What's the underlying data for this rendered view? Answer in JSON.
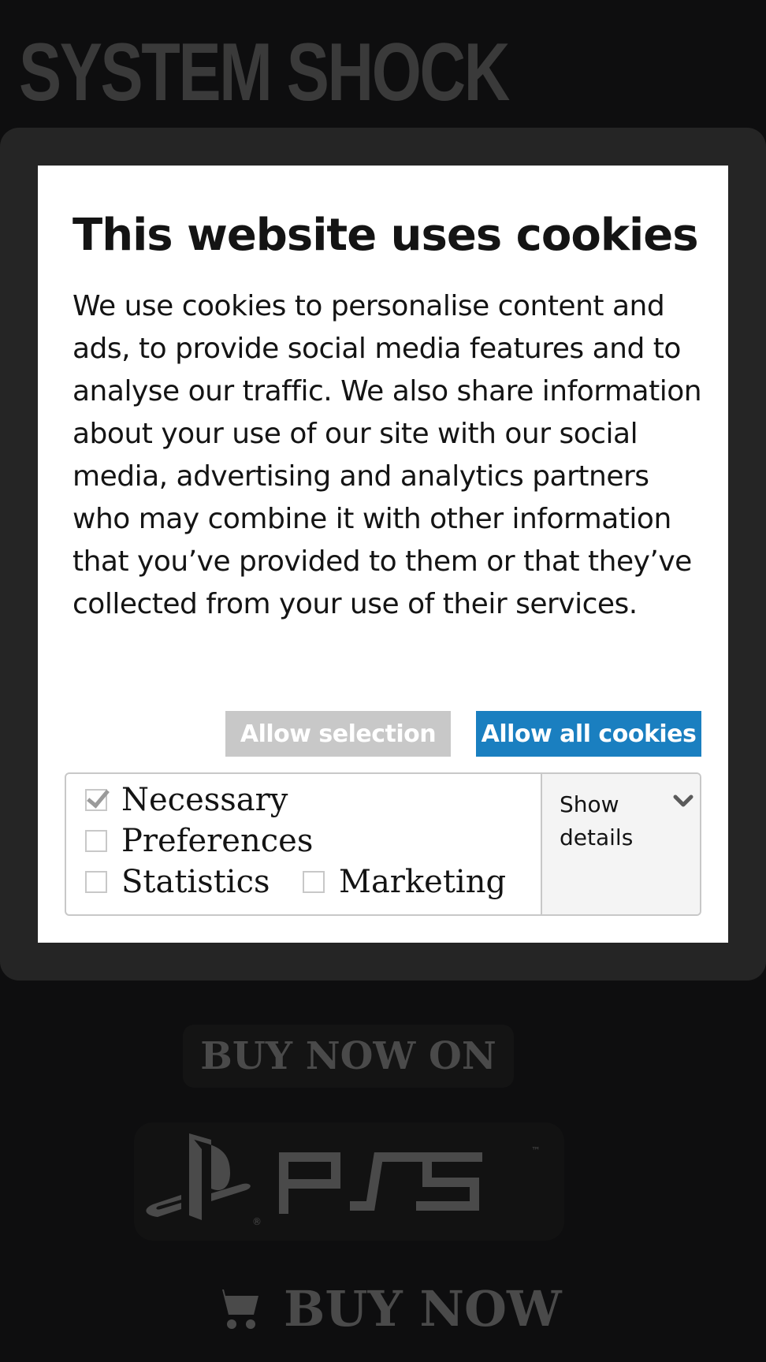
{
  "background": {
    "logo_text": "SYSTEM SHOCK",
    "buy_now_on": "BUY NOW ON",
    "platform_logo": "PS5",
    "buy_now": "BUY NOW",
    "cart_icon": "shopping-cart-icon"
  },
  "cookie_dialog": {
    "title": "This website uses cookies",
    "body": "We use cookies to personalise content and ads, to provide social media features and to analyse our traffic. We also share information about your use of our site with our social media, advertising and analytics partners who may combine it with other information that you’ve provided to them or that they’ve collected from your use of their services.",
    "allow_selection_label": "Allow selection",
    "allow_all_label": "Allow all cookies",
    "accent_color": "#1a7fc0",
    "options": [
      {
        "label": "Necessary",
        "checked": true,
        "disabled": true
      },
      {
        "label": "Preferences",
        "checked": false
      },
      {
        "label": "Statistics",
        "checked": false
      },
      {
        "label": "Marketing",
        "checked": false
      }
    ],
    "show_details_label": "Show details",
    "chevron_icon": "chevron-down-icon"
  }
}
